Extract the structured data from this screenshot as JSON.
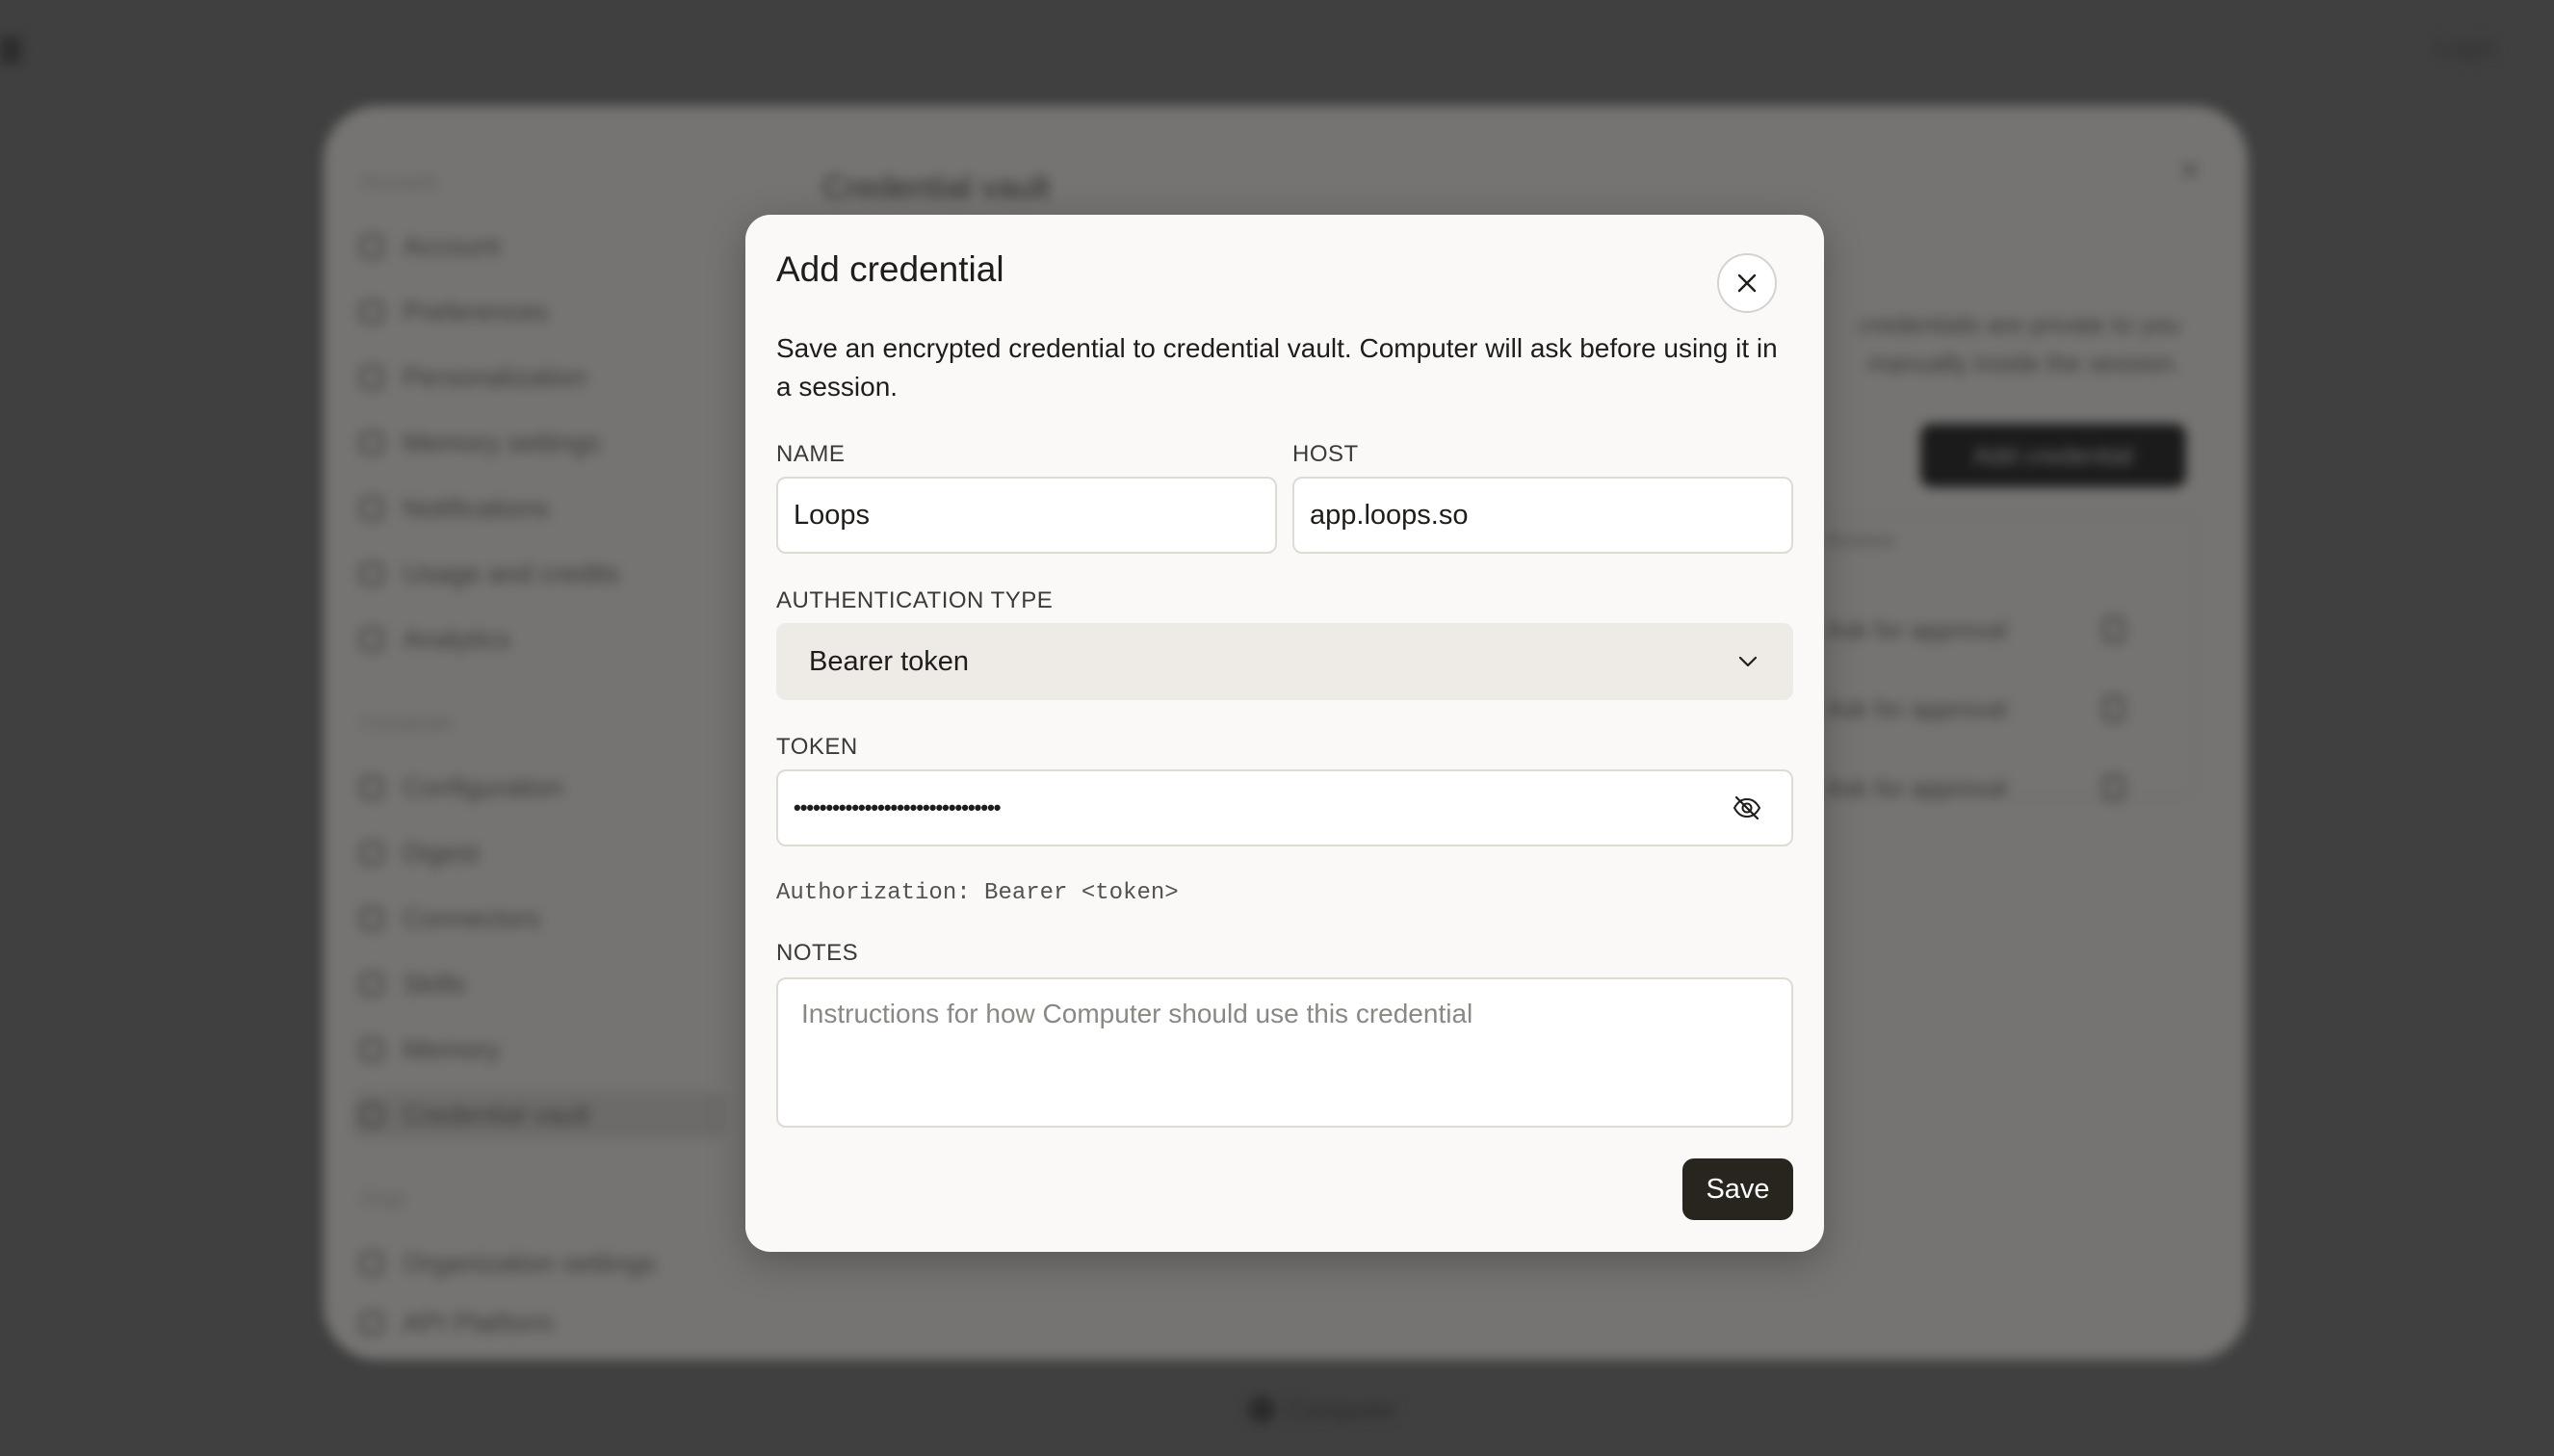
{
  "background": {
    "top_right_label": "Login",
    "settings_panel": {
      "groups": [
        "Account",
        "Computer",
        "Orgs"
      ],
      "account_items": [
        "Account",
        "Preferences",
        "Personalization",
        "Memory settings",
        "Notifications",
        "Usage and credits",
        "Analytics"
      ],
      "computer_items": [
        "Configuration",
        "Digest",
        "Connectors",
        "Skills",
        "Memory",
        "Credential vault"
      ],
      "org_items": [
        "Organization settings",
        "API Platform"
      ],
      "main_title": "Credential vault",
      "desc_line1": "credentials are private to you",
      "desc_line2": "manually inside the session.",
      "add_button": "Add credential",
      "table_header": "Access",
      "rows": [
        "Ask for approval",
        "Ask for approval",
        "Ask for approval"
      ]
    },
    "bottom_chip": "Computer"
  },
  "modal": {
    "title": "Add credential",
    "description": "Save an encrypted credential to credential vault. Computer will ask before using it in a session.",
    "name_label": "NAME",
    "name_value": "Loops",
    "host_label": "HOST",
    "host_value": "app.loops.so",
    "auth_type_label": "AUTHENTICATION TYPE",
    "auth_type_value": "Bearer token",
    "token_label": "TOKEN",
    "token_masked": "••••••••••••••••••••••••••••••••",
    "auth_hint": "Authorization: Bearer <token>",
    "notes_label": "NOTES",
    "notes_placeholder": "Instructions for how Computer should use this credential",
    "save_label": "Save",
    "icons": {
      "close": "close-icon",
      "select_chevron": "chevron-down-icon",
      "token_visibility": "eye-off-icon"
    }
  }
}
